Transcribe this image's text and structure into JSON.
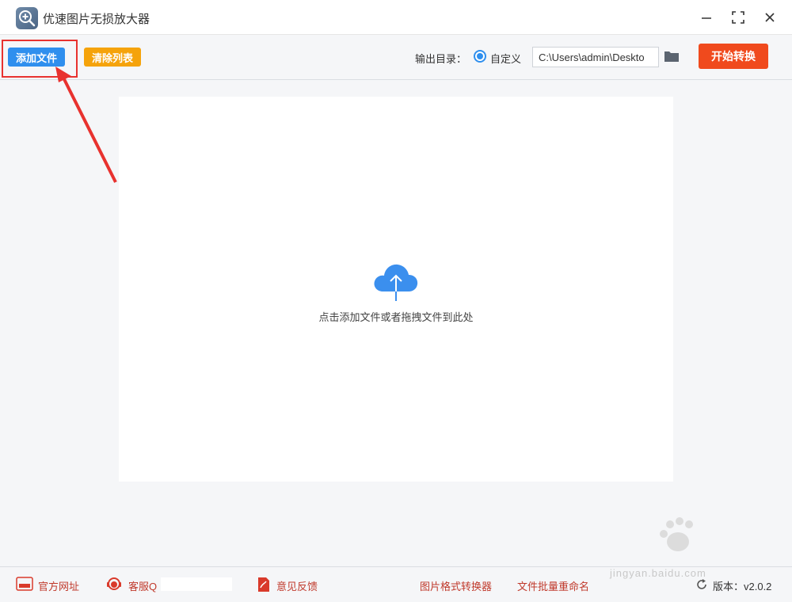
{
  "window": {
    "title": "优速图片无损放大器"
  },
  "toolbar": {
    "add_file_label": "添加文件",
    "clear_list_label": "清除列表",
    "output_dir_label": "输出目录：",
    "custom_option_label": "自定义",
    "output_path_value": "C:\\Users\\admin\\Deskto",
    "start_label": "开始转换"
  },
  "dropzone": {
    "hint": "点击添加文件或者拖拽文件到此处"
  },
  "footer": {
    "website_label": "官方网址",
    "support_label": "客服Q",
    "feedback_label": "意见反馈",
    "format_converter_label": "图片格式转换器",
    "batch_rename_label": "文件批量重命名",
    "version_label": "版本：v2.0.2"
  },
  "watermark": {
    "text": "jingyan.baidu.com"
  },
  "colors": {
    "add_button": "#2f8fee",
    "clear_button": "#f5a30b",
    "start_button": "#f04a1d",
    "annotation": "#e8322f"
  },
  "icons": [
    "app-logo-icon",
    "minimize-icon",
    "maximize-icon",
    "close-icon",
    "folder-icon",
    "cloud-upload-icon",
    "website-icon",
    "support-icon",
    "feedback-icon",
    "refresh-icon"
  ]
}
